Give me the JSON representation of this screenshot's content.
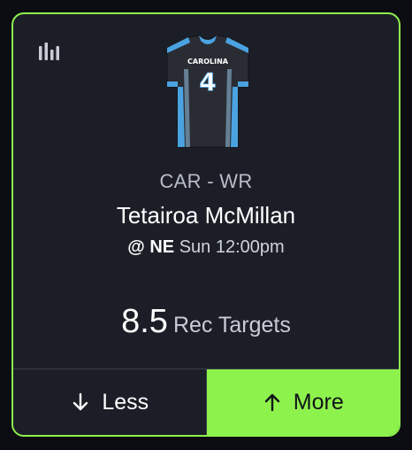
{
  "card": {
    "icon": "bar-chart-icon",
    "jersey": {
      "team_text": "CAROLINA",
      "number": "4",
      "colors": {
        "body": "#2a2c33",
        "accent": "#4aa3e0",
        "number": "#ffffff"
      }
    },
    "team_position": "CAR - WR",
    "player_name": "Tetairoa McMillan",
    "matchup": {
      "at_opponent": "@ NE",
      "time": "Sun 12:00pm"
    },
    "projection": {
      "value": "8.5",
      "stat": "Rec Targets"
    },
    "buttons": {
      "less": {
        "label": "Less",
        "icon": "arrow-down-icon"
      },
      "more": {
        "label": "More",
        "icon": "arrow-up-icon"
      }
    },
    "colors": {
      "accent": "#8ef24c",
      "card_bg": "#1c1e27",
      "page_bg": "#0b0d12"
    }
  }
}
